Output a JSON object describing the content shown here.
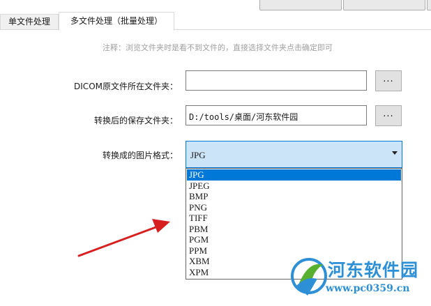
{
  "tabs": [
    {
      "label": "单文件处理",
      "active": false
    },
    {
      "label": "多文件处理（批量处理）",
      "active": true
    }
  ],
  "note": "注释：浏览文件夹时是看不到文件的，直接选择文件夹点击确定即可",
  "form": {
    "dicom_label": "DICOM原文件所在文件夹：",
    "dicom_value": "",
    "save_label": "转换后的保存文件夹：",
    "save_value": "D:/tools/桌面/河东软件园",
    "browse_label": "...",
    "format_label": "转换成的图片格式：",
    "format_value": "JPG"
  },
  "format_options": [
    "JPG",
    "JPEG",
    "BMP",
    "PNG",
    "TIFF",
    "PBM",
    "PGM",
    "PPM",
    "XBM",
    "XPM"
  ],
  "selected_option": "JPG",
  "watermark": {
    "name": "河东软件园",
    "url": "www.pc0359.cn"
  },
  "colors": {
    "accent": "#0078d7",
    "selection_bg": "#cce4f7",
    "arrow": "#d62020",
    "watermark": "#2d8fd6"
  }
}
